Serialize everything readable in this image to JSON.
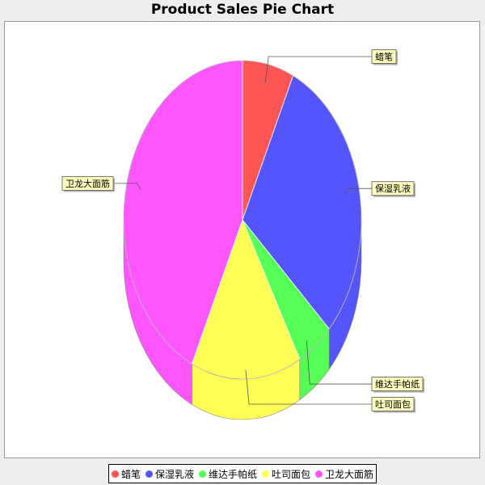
{
  "chart_data": {
    "type": "pie",
    "title": "Product Sales Pie Chart",
    "categories": [
      "蜡笔",
      "保湿乳液",
      "维达手帕纸",
      "吐司面包",
      "卫龙大面筋"
    ],
    "values": [
      7,
      30,
      5,
      15,
      43
    ],
    "colors": [
      "#ff5555",
      "#5555ff",
      "#55ff55",
      "#ffff55",
      "#ff55ff"
    ],
    "legend_position": "bottom",
    "three_d": true,
    "section_labels": true
  }
}
